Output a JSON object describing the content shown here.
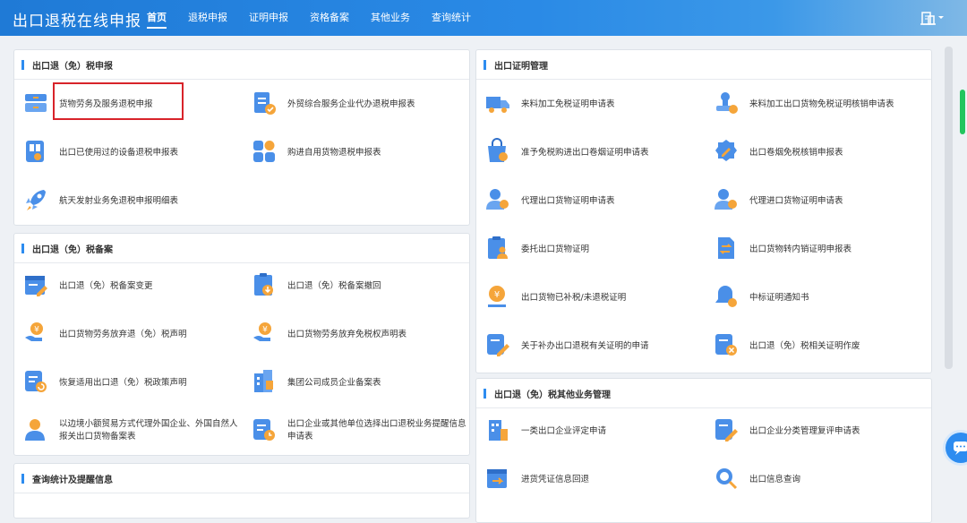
{
  "header": {
    "app_title": "出口退税在线申报",
    "nav": [
      {
        "label": "首页",
        "active": true
      },
      {
        "label": "退税申报"
      },
      {
        "label": "证明申报"
      },
      {
        "label": "资格备案"
      },
      {
        "label": "其他业务"
      },
      {
        "label": "查询统计"
      }
    ],
    "user_icon": "building-icon"
  },
  "colors": {
    "accent": "#2d8cf0",
    "icon_blue": "#4a8fe8",
    "icon_orange": "#f5a53a",
    "highlight": "#d8232a"
  },
  "panels": {
    "declare": {
      "title": "出口退（免）税申报",
      "items": [
        "货物劳务及服务退税申报",
        "外贸综合服务企业代办退税申报表",
        "出口已使用过的设备退税申报表",
        "购进自用货物退税申报表",
        "航天发射业务免退税申报明细表"
      ]
    },
    "record": {
      "title": "出口退（免）税备案",
      "items": [
        "出口退（免）税备案变更",
        "出口退（免）税备案撤回",
        "出口货物劳务放弃退（免）税声明",
        "出口货物劳务放弃免税权声明表",
        "恢复适用出口退（免）税政策声明",
        "集团公司成员企业备案表",
        "以边境小额贸易方式代理外国企业、外国自然人报关出口货物备案表",
        "出口企业或其他单位选择出口退税业务提醒信息申请表"
      ]
    },
    "query": {
      "title": "查询统计及提醒信息"
    },
    "certificate": {
      "title": "出口证明管理",
      "items": [
        "来料加工免税证明申请表",
        "来料加工出口货物免税证明核销申请表",
        "准予免税购进出口卷烟证明申请表",
        "出口卷烟免税核销申报表",
        "代理出口货物证明申请表",
        "代理进口货物证明申请表",
        "委托出口货物证明",
        "出口货物转内销证明申报表",
        "出口货物已补税/未退税证明",
        "中标证明通知书",
        "关于补办出口退税有关证明的申请",
        "出口退（免）税相关证明作废"
      ]
    },
    "other": {
      "title": "出口退（免）税其他业务管理",
      "items": [
        "一类出口企业评定申请",
        "出口企业分类管理复评申请表",
        "进货凭证信息回退",
        "出口信息查询"
      ]
    }
  }
}
